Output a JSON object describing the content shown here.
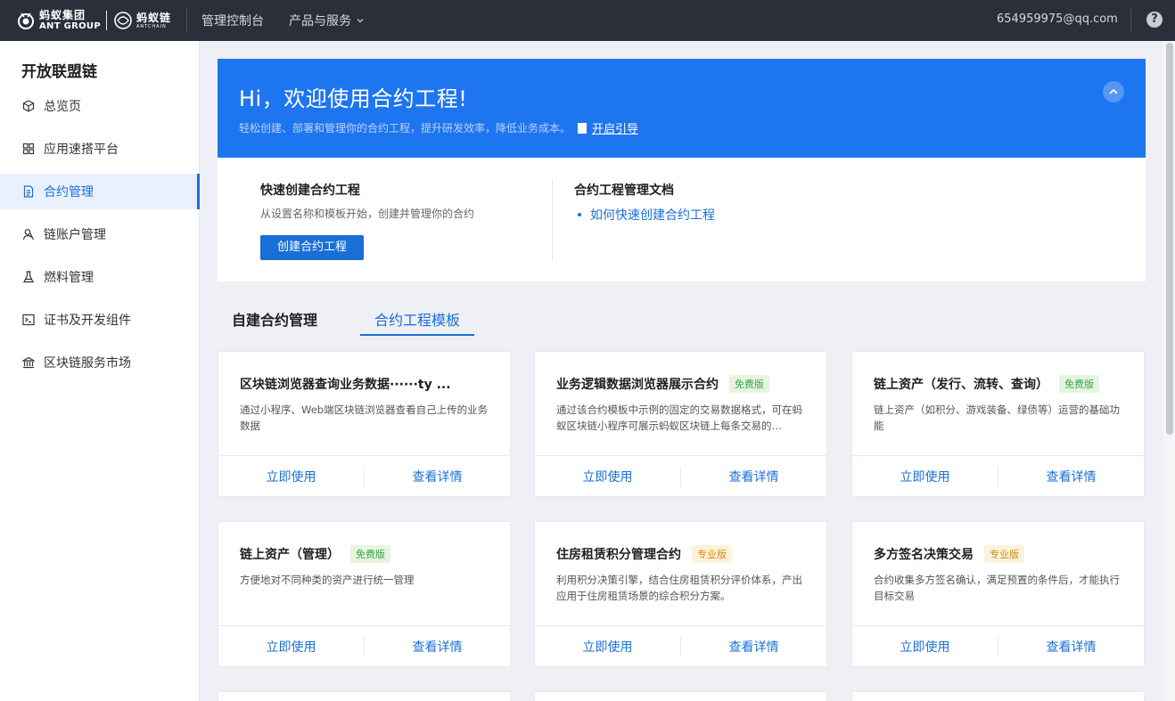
{
  "header": {
    "logo_group_cn": "蚂蚁集团",
    "logo_group_en": "ANT GROUP",
    "logo_chain_cn": "蚂蚁链",
    "logo_chain_en": "ANTCHAIN",
    "nav_console": "管理控制台",
    "nav_products": "产品与服务",
    "user_email": "654959975@qq.com",
    "help": "?"
  },
  "sidebar": {
    "title": "开放联盟链",
    "items": [
      {
        "label": "总览页",
        "icon": "cube-icon"
      },
      {
        "label": "应用速搭平台",
        "icon": "grid-icon"
      },
      {
        "label": "合约管理",
        "icon": "document-icon",
        "active": true
      },
      {
        "label": "链账户管理",
        "icon": "users-icon"
      },
      {
        "label": "燃料管理",
        "icon": "flask-icon"
      },
      {
        "label": "证书及开发组件",
        "icon": "terminal-icon"
      },
      {
        "label": "区块链服务市场",
        "icon": "bank-icon"
      }
    ]
  },
  "banner": {
    "title": "Hi，欢迎使用合约工程!",
    "subtitle": "轻松创建、部署和管理你的合约工程，提升研发效率，降低业务成本。",
    "guide_link": "开启引导"
  },
  "quick": {
    "title": "快速创建合约工程",
    "desc": "从设置名称和模板开始，创建并管理你的合约",
    "button": "创建合约工程",
    "doc_title": "合约工程管理文档",
    "doc_link": "如何快速创建合约工程"
  },
  "tabs": {
    "self": "自建合约管理",
    "template": "合约工程模板"
  },
  "cards": [
    {
      "title": "区块链浏览器查询业务数据······ty ...",
      "badge": "",
      "badge_type": "",
      "desc": "通过小程序、Web端区块链浏览器查看自己上传的业务数据",
      "use": "立即使用",
      "detail": "查看详情"
    },
    {
      "title": "业务逻辑数据浏览器展示合约",
      "badge": "免费版",
      "badge_type": "free",
      "desc": "通过该合约模板中示例的固定的交易数据格式，可在蚂蚁区块链小程序可展示蚂蚁区块链上每条交易的…",
      "use": "立即使用",
      "detail": "查看详情"
    },
    {
      "title": "链上资产（发行、流转、查询）",
      "badge": "免费版",
      "badge_type": "free",
      "desc": "链上资产（如积分、游戏装备、绿债等）运营的基础功能",
      "use": "立即使用",
      "detail": "查看详情"
    },
    {
      "title": "链上资产（管理）",
      "badge": "免费版",
      "badge_type": "free",
      "desc": "方便地对不同种类的资产进行统一管理",
      "use": "立即使用",
      "detail": "查看详情"
    },
    {
      "title": "住房租赁积分管理合约",
      "badge": "专业版",
      "badge_type": "pro",
      "desc": "利用积分决策引擎，结合住房租赁积分评价体系，产出应用于住房租赁场景的综合积分方案。",
      "use": "立即使用",
      "detail": "查看详情"
    },
    {
      "title": "多方签名决策交易",
      "badge": "专业版",
      "badge_type": "pro",
      "desc": "合约收集多方签名确认，满足预置的条件后，才能执行目标交易",
      "use": "立即使用",
      "detail": "查看详情"
    }
  ],
  "colors": {
    "topbar": "#2b2f3a",
    "banner": "#1e75f0",
    "accent": "#1a6fd6",
    "free_badge": "#3aa34a",
    "pro_badge": "#d38b0b"
  }
}
